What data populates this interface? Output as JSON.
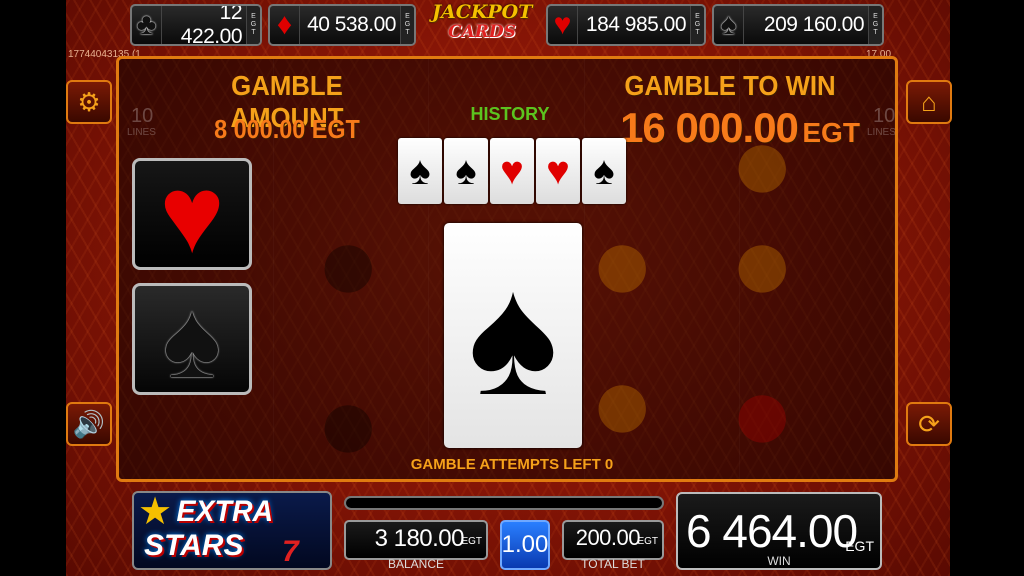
{
  "jackpots": [
    {
      "suit": "♣",
      "value": "12 422.00"
    },
    {
      "suit": "♦",
      "value": "40 538.00"
    },
    {
      "suit": "♥",
      "value": "184 985.00"
    },
    {
      "suit": "♠",
      "value": "209 160.00"
    }
  ],
  "jackpot_unit": "EGT",
  "logo": {
    "line1": "JACKPOT",
    "line2": "CARDS"
  },
  "session_id": "17744043135 (1",
  "session_right": "17.00",
  "gamble": {
    "amount_label": "GAMBLE AMOUNT",
    "amount_value": "8 000.00 EGT",
    "win_label": "GAMBLE TO WIN",
    "win_value": "16 000.00",
    "win_unit": "EGT",
    "history_label": "HISTORY",
    "history": [
      {
        "suit": "♠",
        "color": "black"
      },
      {
        "suit": "♠",
        "color": "black"
      },
      {
        "suit": "♥",
        "color": "red"
      },
      {
        "suit": "♥",
        "color": "red"
      },
      {
        "suit": "♠",
        "color": "black"
      }
    ],
    "red_choice": "♥",
    "black_choice": "♠",
    "current_card": "♠",
    "attempts_text": "GAMBLE ATTEMPTS LEFT 0"
  },
  "side": {
    "left_top_icon": "gear-icon",
    "left_bottom_icon": "speaker-icon",
    "right_top_icon": "home-icon",
    "right_bottom_icon": "autoplay-icon",
    "lines_label": "LINES",
    "lines_number": "10"
  },
  "game_logo": {
    "line1": "EXTRA",
    "line2": "STARS",
    "number": "7"
  },
  "bottom": {
    "balance_value": "3 180.00",
    "balance_label": "BALANCE",
    "denomination": "1.00",
    "total_bet_value": "200.00",
    "total_bet_label": "TOTAL BET",
    "win_value": "6 464.00",
    "win_label": "WIN",
    "unit": "EGT"
  },
  "colors": {
    "accent": "#e07a10",
    "orange_text": "#f5a11a",
    "history_green": "#5cc41f",
    "denom_blue": "#2a7fff"
  }
}
